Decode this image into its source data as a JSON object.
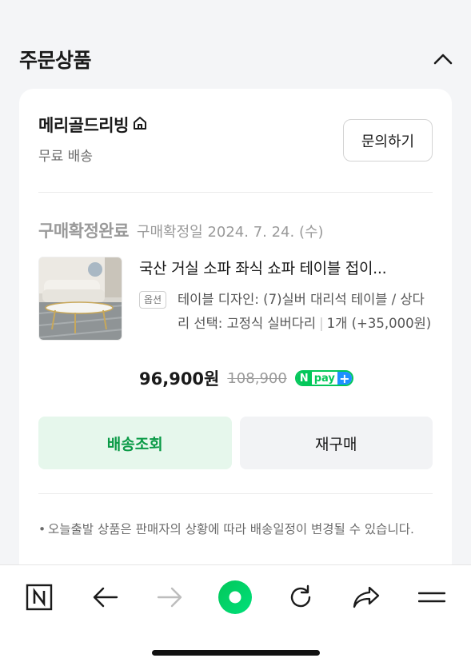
{
  "section": {
    "title": "주문상품"
  },
  "seller": {
    "name": "메리골드리빙",
    "shipping": "무료 배송",
    "inquiry_label": "문의하기"
  },
  "order": {
    "status": "구매확정완료",
    "confirm_date": "구매확정일 2024. 7. 24. (수)"
  },
  "product": {
    "title": "국산 거실 소파 좌식 쇼파 테이블 접이...",
    "option_badge": "옵션",
    "option_text": "테이블 디자인: (7)실버 대리석 테이블 / 상다리 선택: 고정식 실버다리",
    "option_qty": "1개 (+35,000원)",
    "price": "96,900원",
    "original_price": "108,900",
    "npay": {
      "n": "N",
      "word": "pay",
      "plus": "+"
    }
  },
  "actions": {
    "track_label": "배송조회",
    "rebuy_label": "재구매"
  },
  "notice": {
    "bullet": "•",
    "text": "오늘출발 상품은 판매자의 상황에 따라 배송일정이 변경될 수 있습니다."
  },
  "colors": {
    "accent": "#03c75a",
    "track_bg": "#e6f7ec",
    "track_text": "#0a9a46"
  },
  "bottom_nav": [
    "naver-home-icon",
    "back-arrow-icon",
    "forward-arrow-icon",
    "green-dot-icon",
    "refresh-icon",
    "share-icon",
    "menu-icon"
  ]
}
